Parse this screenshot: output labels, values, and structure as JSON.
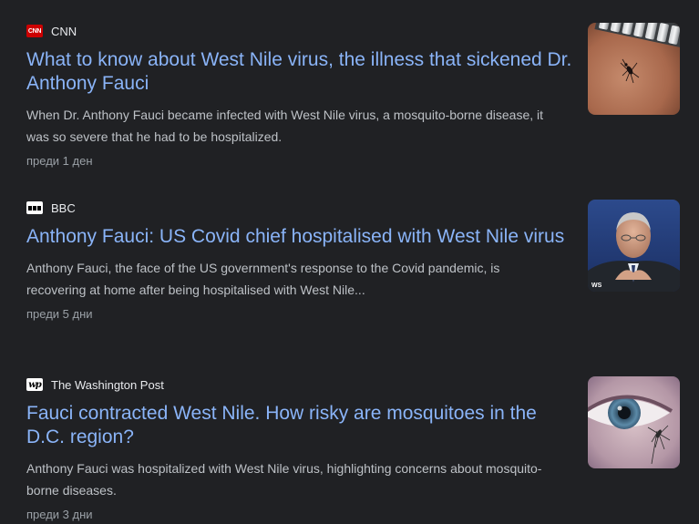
{
  "articles": [
    {
      "source": "CNN",
      "logo_icon": "cnn-logo-icon",
      "logo_text": "CNN",
      "headline": "What to know about West Nile virus, the illness that sickened Dr. Anthony Fauci",
      "snippet": "When Dr. Anthony Fauci became infected with West Nile virus, a mosquito-borne disease, it was so severe that he had to be hospitalized.",
      "age": "преди 1 ден",
      "thumbnail": "mosquito-on-skin-image"
    },
    {
      "source": "BBC",
      "logo_icon": "bbc-logo-icon",
      "headline": "Anthony Fauci: US Covid chief hospitalised with West Nile virus",
      "snippet": "Anthony Fauci, the face of the US government's response to the Covid pandemic, is recovering at home after being hospitalised with West Nile...",
      "age": "преди 5 дни",
      "thumbnail": "fauci-portrait-image",
      "thumbnail_caption": "WS"
    },
    {
      "source": "The Washington Post",
      "logo_icon": "washington-post-logo-icon",
      "logo_text": "wp",
      "headline": "Fauci contracted West Nile. How risky are mosquitoes in the D.C. region?",
      "snippet": "Anthony Fauci was hospitalized with West Nile virus, highlighting concerns about mosquito-borne diseases.",
      "age": "преди 3 дни",
      "thumbnail": "eye-closeup-image"
    }
  ],
  "colors": {
    "background": "#202124",
    "headline": "#8ab4f8",
    "snippet": "#bdc1c6",
    "meta": "#9aa0a6",
    "source": "#e8eaed",
    "cnn_red": "#cc0000"
  }
}
